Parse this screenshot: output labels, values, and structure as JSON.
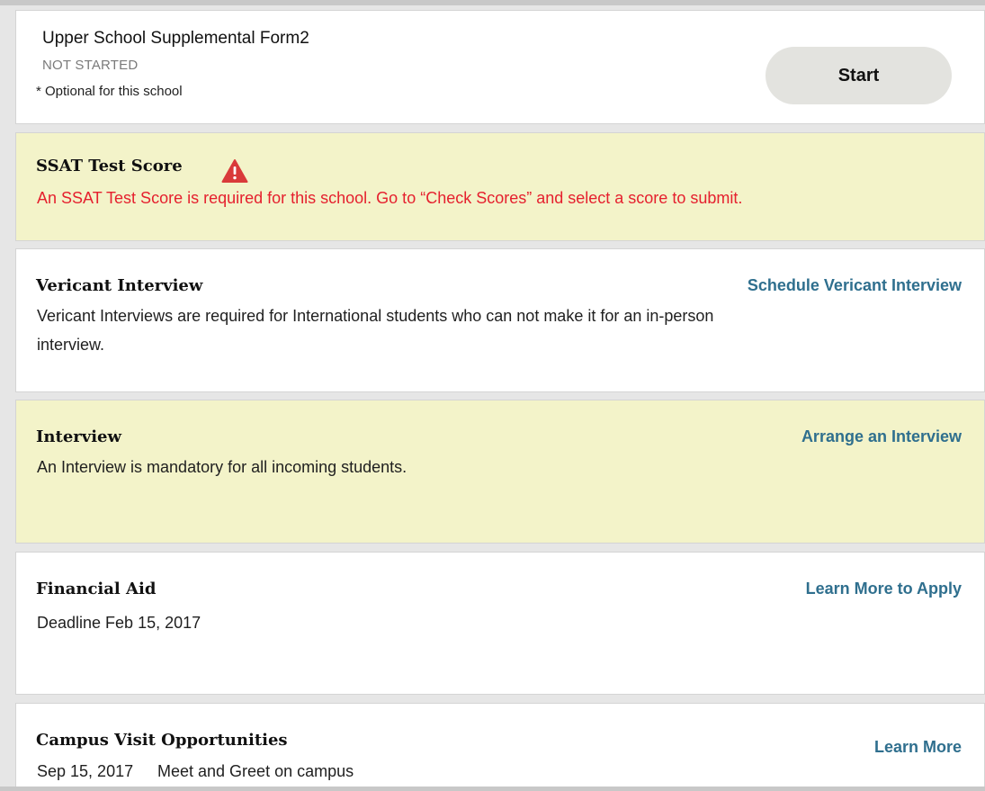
{
  "form": {
    "title": "Upper School Supplemental Form2",
    "status": "NOT STARTED",
    "note": "* Optional for this school",
    "start_label": "Start"
  },
  "ssat": {
    "title": "SSAT Test Score",
    "warning": "An SSAT Test Score is required for this school. Go to “Check Scores” and select a score to submit.",
    "warning_color": "#e5202e"
  },
  "vericant": {
    "title": "Vericant Interview",
    "link": "Schedule Vericant Interview",
    "description": "Vericant Interviews are required for International students who can not make it for an in-person interview."
  },
  "interview": {
    "title": "Interview",
    "link": "Arrange an Interview",
    "description": "An Interview is mandatory for all incoming students."
  },
  "financial_aid": {
    "title": "Financial Aid",
    "link": "Learn More to Apply",
    "description": "Deadline Feb 15, 2017"
  },
  "campus_visit": {
    "title": "Campus Visit Opportunities",
    "link": "Learn More",
    "date": "Sep 15, 2017",
    "event": "Meet and Greet on campus"
  },
  "colors": {
    "link": "#2f6f8e",
    "alert_background": "#f3f3c9",
    "button_background": "#e3e3df"
  }
}
